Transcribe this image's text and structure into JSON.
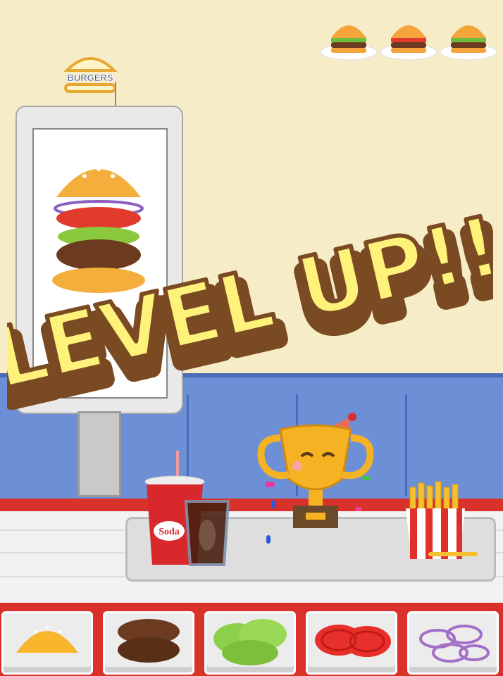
{
  "header": {
    "sign_label": "BURGERS",
    "order_plates": [
      "burger-icon",
      "burger-icon",
      "burger-icon"
    ]
  },
  "banner": {
    "text": "LEVEL UP!!"
  },
  "soda": {
    "label": "Soda"
  },
  "ingredients": [
    "bun-icon",
    "patty-icon",
    "lettuce-icon",
    "tomato-icon",
    "onion-icon"
  ],
  "colors": {
    "wall": "#f7ecc8",
    "panel": "#6c8fd6",
    "counter_red": "#d8322a",
    "banner_fill": "#fff27a",
    "banner_shadow": "#7a4a22"
  }
}
